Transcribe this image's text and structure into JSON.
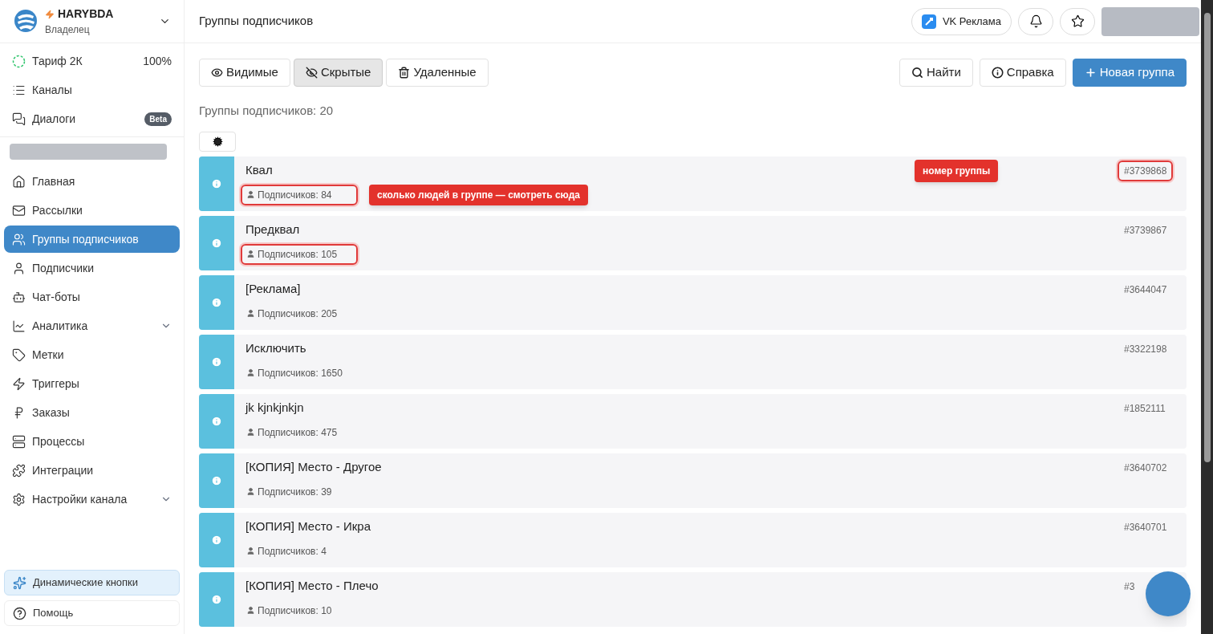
{
  "account": {
    "name": "HARYBDA",
    "role": "Владелец"
  },
  "plan": {
    "label": "Тариф 2К",
    "reading": "100%"
  },
  "top_nav": [
    {
      "label": "Каналы"
    },
    {
      "label": "Диалоги",
      "badge": "Beta"
    }
  ],
  "nav": [
    {
      "label": "Главная",
      "selected": false,
      "expandable": false
    },
    {
      "label": "Рассылки",
      "selected": false,
      "expandable": false
    },
    {
      "label": "Группы подписчиков",
      "selected": true,
      "expandable": false
    },
    {
      "label": "Подписчики",
      "selected": false,
      "expandable": false
    },
    {
      "label": "Чат-боты",
      "selected": false,
      "expandable": false
    },
    {
      "label": "Аналитика",
      "selected": false,
      "expandable": true
    },
    {
      "label": "Метки",
      "selected": false,
      "expandable": false
    },
    {
      "label": "Триггеры",
      "selected": false,
      "expandable": false
    },
    {
      "label": "Заказы",
      "selected": false,
      "expandable": false
    },
    {
      "label": "Процессы",
      "selected": false,
      "expandable": false
    },
    {
      "label": "Интеграции",
      "selected": false,
      "expandable": false
    },
    {
      "label": "Настройки канала",
      "selected": false,
      "expandable": true
    }
  ],
  "bottom_nav": [
    {
      "label": "Динамические кнопки",
      "kind": "highlight"
    },
    {
      "label": "Помощь",
      "kind": "plain"
    }
  ],
  "page_title": "Группы подписчиков",
  "vk_button": "VK Реклама",
  "tabs": [
    {
      "label": "Видимые",
      "selected": false
    },
    {
      "label": "Скрытые",
      "selected": true
    },
    {
      "label": "Удаленные",
      "selected": false
    }
  ],
  "actions": [
    {
      "label": "Найти",
      "kind": "search"
    },
    {
      "label": "Справка",
      "kind": "info"
    },
    {
      "label": "Новая группа",
      "kind": "primary"
    }
  ],
  "count_label": "Группы подписчиков: 20",
  "groups": [
    {
      "name": "Квал",
      "subscribers": "Подписчиков: 84",
      "id": "#3739868",
      "count_marked": true,
      "id_marked": true,
      "count_note": "сколько людей в группе — смотреть сюда",
      "id_note": "номер группы"
    },
    {
      "name": "Предквал",
      "subscribers": "Подписчиков: 105",
      "id": "#3739867",
      "count_marked": true,
      "id_marked": false
    },
    {
      "name": "[Реклама]",
      "subscribers": "Подписчиков: 205",
      "id": "#3644047",
      "count_marked": false,
      "id_marked": false
    },
    {
      "name": "Исключить",
      "subscribers": "Подписчиков: 1650",
      "id": "#3322198",
      "count_marked": false,
      "id_marked": false
    },
    {
      "name": "jk kjnkjnkjn",
      "subscribers": "Подписчиков: 475",
      "id": "#1852111",
      "count_marked": false,
      "id_marked": false
    },
    {
      "name": "[КОПИЯ] Место - Другое",
      "subscribers": "Подписчиков: 39",
      "id": "#3640702",
      "count_marked": false,
      "id_marked": false
    },
    {
      "name": "[КОПИЯ] Место - Икра",
      "subscribers": "Подписчиков: 4",
      "id": "#3640701",
      "count_marked": false,
      "id_marked": false
    },
    {
      "name": "[КОПИЯ] Место - Плечо",
      "subscribers": "Подписчиков: 10",
      "id": "#3",
      "count_marked": false,
      "id_marked": false
    }
  ]
}
